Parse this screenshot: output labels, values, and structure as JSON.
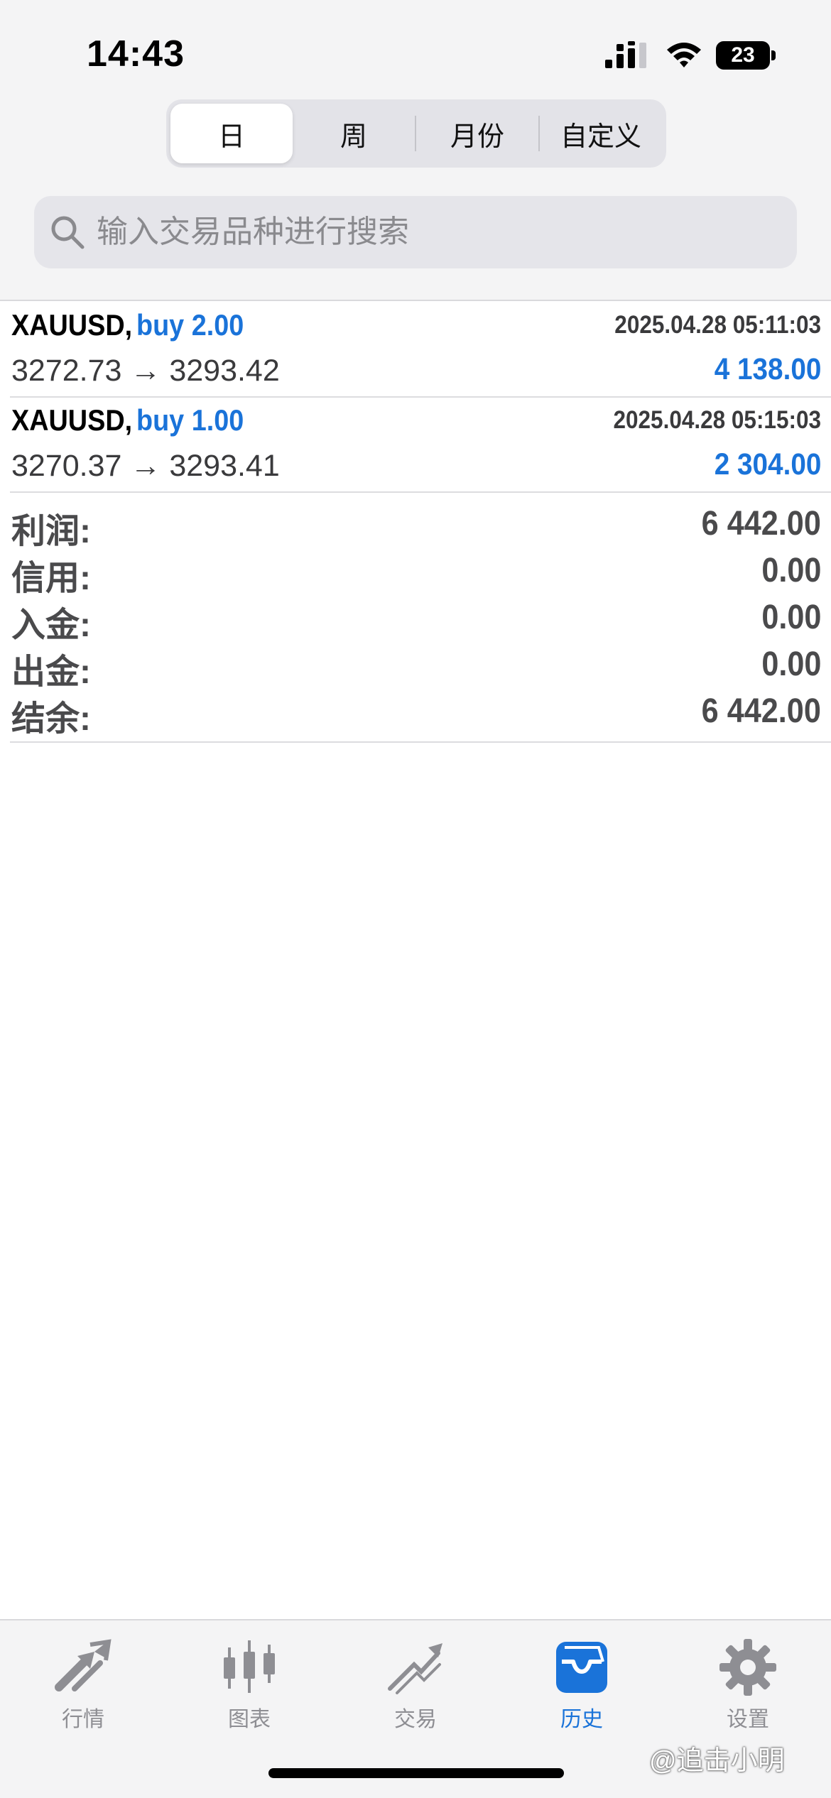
{
  "status_bar": {
    "time": "14:43",
    "battery": "23"
  },
  "period_tabs": [
    {
      "label": "日",
      "active": true
    },
    {
      "label": "周",
      "active": false
    },
    {
      "label": "月份",
      "active": false
    },
    {
      "label": "自定义",
      "active": false
    }
  ],
  "search": {
    "placeholder": "输入交易品种进行搜索",
    "value": ""
  },
  "deals": [
    {
      "symbol": "XAUUSD,",
      "action": "buy 2.00",
      "time": "2025.04.28 05:11:03",
      "prices": "3272.73 → 3293.42",
      "profit": "4 138.00"
    },
    {
      "symbol": "XAUUSD,",
      "action": "buy 1.00",
      "time": "2025.04.28 05:15:03",
      "prices": "3270.37 → 3293.41",
      "profit": "2 304.00"
    }
  ],
  "summary": [
    {
      "label": "利润:",
      "value": "6 442.00"
    },
    {
      "label": "信用:",
      "value": "0.00"
    },
    {
      "label": "入金:",
      "value": "0.00"
    },
    {
      "label": "出金:",
      "value": "0.00"
    },
    {
      "label": "结余:",
      "value": "6 442.00"
    }
  ],
  "tab_bar": [
    {
      "label": "行情",
      "icon": "quotes-arrows-icon",
      "active": false
    },
    {
      "label": "图表",
      "icon": "candlestick-chart-icon",
      "active": false
    },
    {
      "label": "交易",
      "icon": "trade-trend-icon",
      "active": false
    },
    {
      "label": "历史",
      "icon": "history-inbox-icon",
      "active": true
    },
    {
      "label": "设置",
      "icon": "gear-icon",
      "active": false
    }
  ],
  "watermark": "@追击小明",
  "colors": {
    "accent": "#1a73d9",
    "inactive": "#8e8e93",
    "background": "#f4f4f5"
  }
}
